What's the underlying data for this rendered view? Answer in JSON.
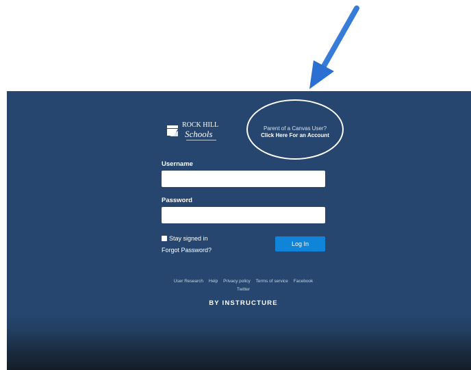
{
  "logo": {
    "brand_line1": "ROCK HILL",
    "brand_line2": "Schools"
  },
  "parent": {
    "line1": "Parent of a Canvas User?",
    "line2": "Click Here For an Account"
  },
  "form": {
    "username_label": "Username",
    "username_value": "",
    "password_label": "Password",
    "password_value": "",
    "stay_signed_in_label": "Stay signed in",
    "forgot_password_label": "Forgot Password?",
    "login_button_label": "Log In"
  },
  "footer": {
    "links": [
      "User Research",
      "Help",
      "Privacy policy",
      "Terms of service",
      "Facebook",
      "Twitter"
    ],
    "brand": "BY INSTRUCTURE"
  },
  "colors": {
    "panel_bg": "#26466f",
    "button_bg": "#0f84d8",
    "arrow": "#2f7de0"
  }
}
